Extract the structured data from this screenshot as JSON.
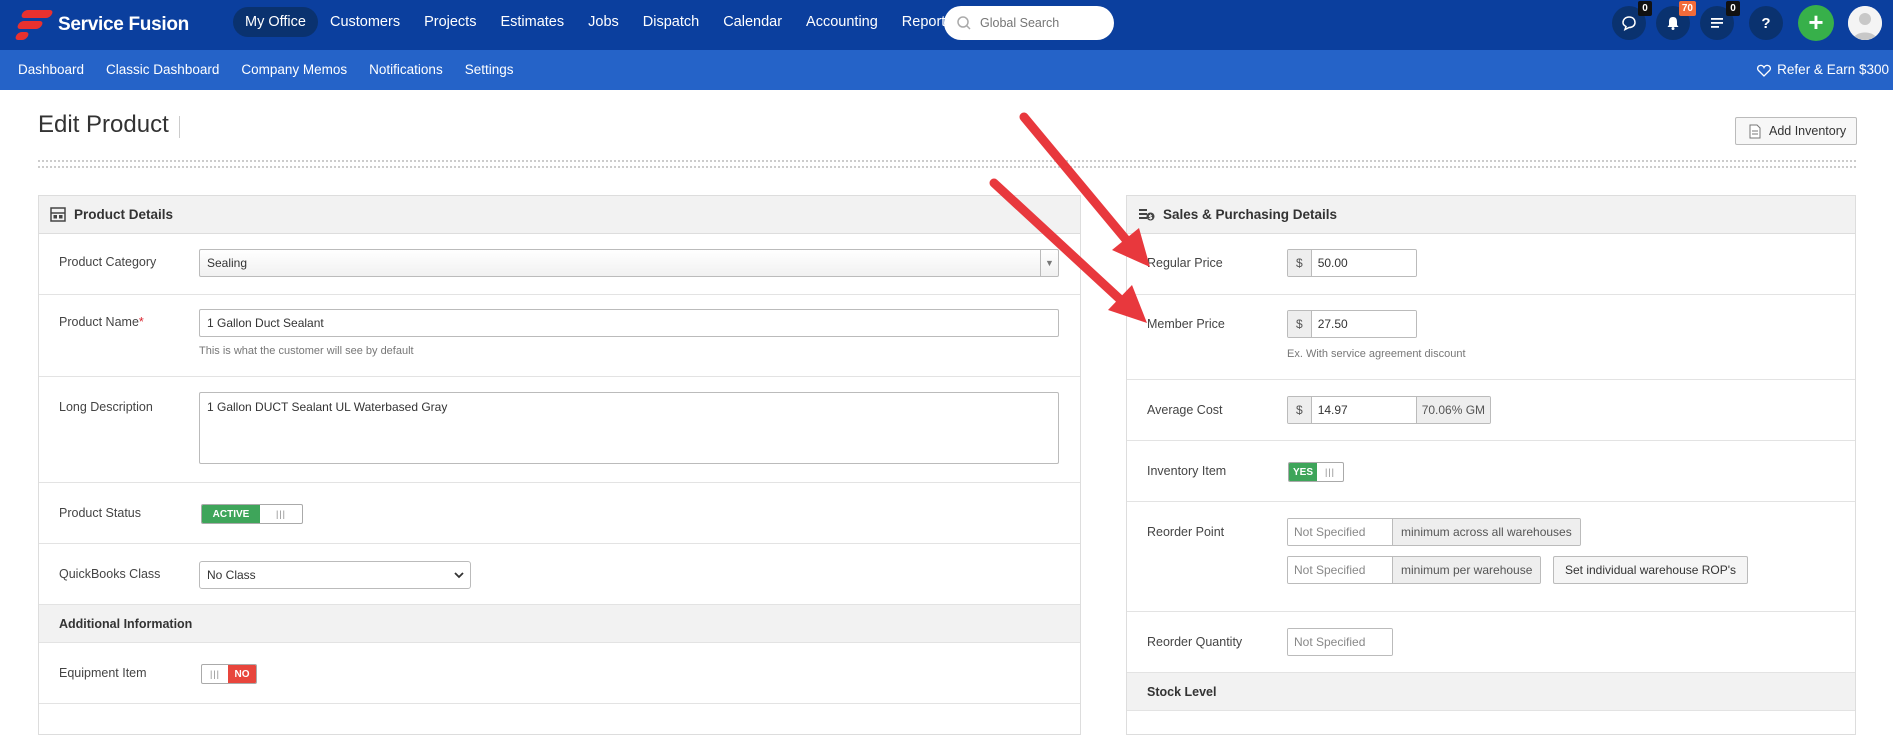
{
  "app": {
    "name": "Service Fusion"
  },
  "nav": {
    "items": [
      "My Office",
      "Customers",
      "Projects",
      "Estimates",
      "Jobs",
      "Dispatch",
      "Calendar",
      "Accounting",
      "Reports"
    ],
    "active": "My Office"
  },
  "search": {
    "placeholder": "Global Search"
  },
  "topbar_icons": {
    "chat_count": "0",
    "notifications_count": "70",
    "tasks_count": "0",
    "help": "?",
    "add": "+"
  },
  "subnav": {
    "items": [
      "Dashboard",
      "Classic Dashboard",
      "Company Memos",
      "Notifications",
      "Settings"
    ],
    "refer": "Refer & Earn $300"
  },
  "page": {
    "title": "Edit Product",
    "add_inventory_label": "Add Inventory"
  },
  "product_details": {
    "header": "Product Details",
    "category_label": "Product Category",
    "category_value": "Sealing",
    "name_label": "Product Name",
    "name_required": "*",
    "name_value": "1 Gallon Duct Sealant",
    "name_hint": "This is what the customer will see by default",
    "description_label": "Long Description",
    "description_value": "1 Gallon DUCT Sealant UL Waterbased Gray",
    "status_label": "Product Status",
    "status_value": "ACTIVE",
    "qb_class_label": "QuickBooks Class",
    "qb_class_value": "No Class",
    "additional_header": "Additional Information",
    "equipment_label": "Equipment Item",
    "equipment_value": "NO"
  },
  "sales": {
    "header": "Sales & Purchasing Details",
    "currency": "$",
    "regular_price_label": "Regular Price",
    "regular_price": "50.00",
    "member_price_label": "Member Price",
    "member_price": "27.50",
    "member_hint": "Ex. With service agreement discount",
    "avg_cost_label": "Average Cost",
    "avg_cost": "14.97",
    "gm": "70.06% GM",
    "inventory_label": "Inventory Item",
    "inventory_value": "YES",
    "reorder_point_label": "Reorder Point",
    "placeholder": "Not Specified",
    "min_all": "minimum across all warehouses",
    "min_per": "minimum per warehouse",
    "set_rop": "Set individual warehouse ROP's",
    "reorder_qty_label": "Reorder Quantity",
    "stock_level_header": "Stock Level"
  },
  "colors": {
    "topbar": "#0b3f9e",
    "subnav": "#2563c8",
    "active_toggle": "#3ea55a",
    "inactive_toggle": "#e8453c",
    "arrow": "#e8383d"
  }
}
